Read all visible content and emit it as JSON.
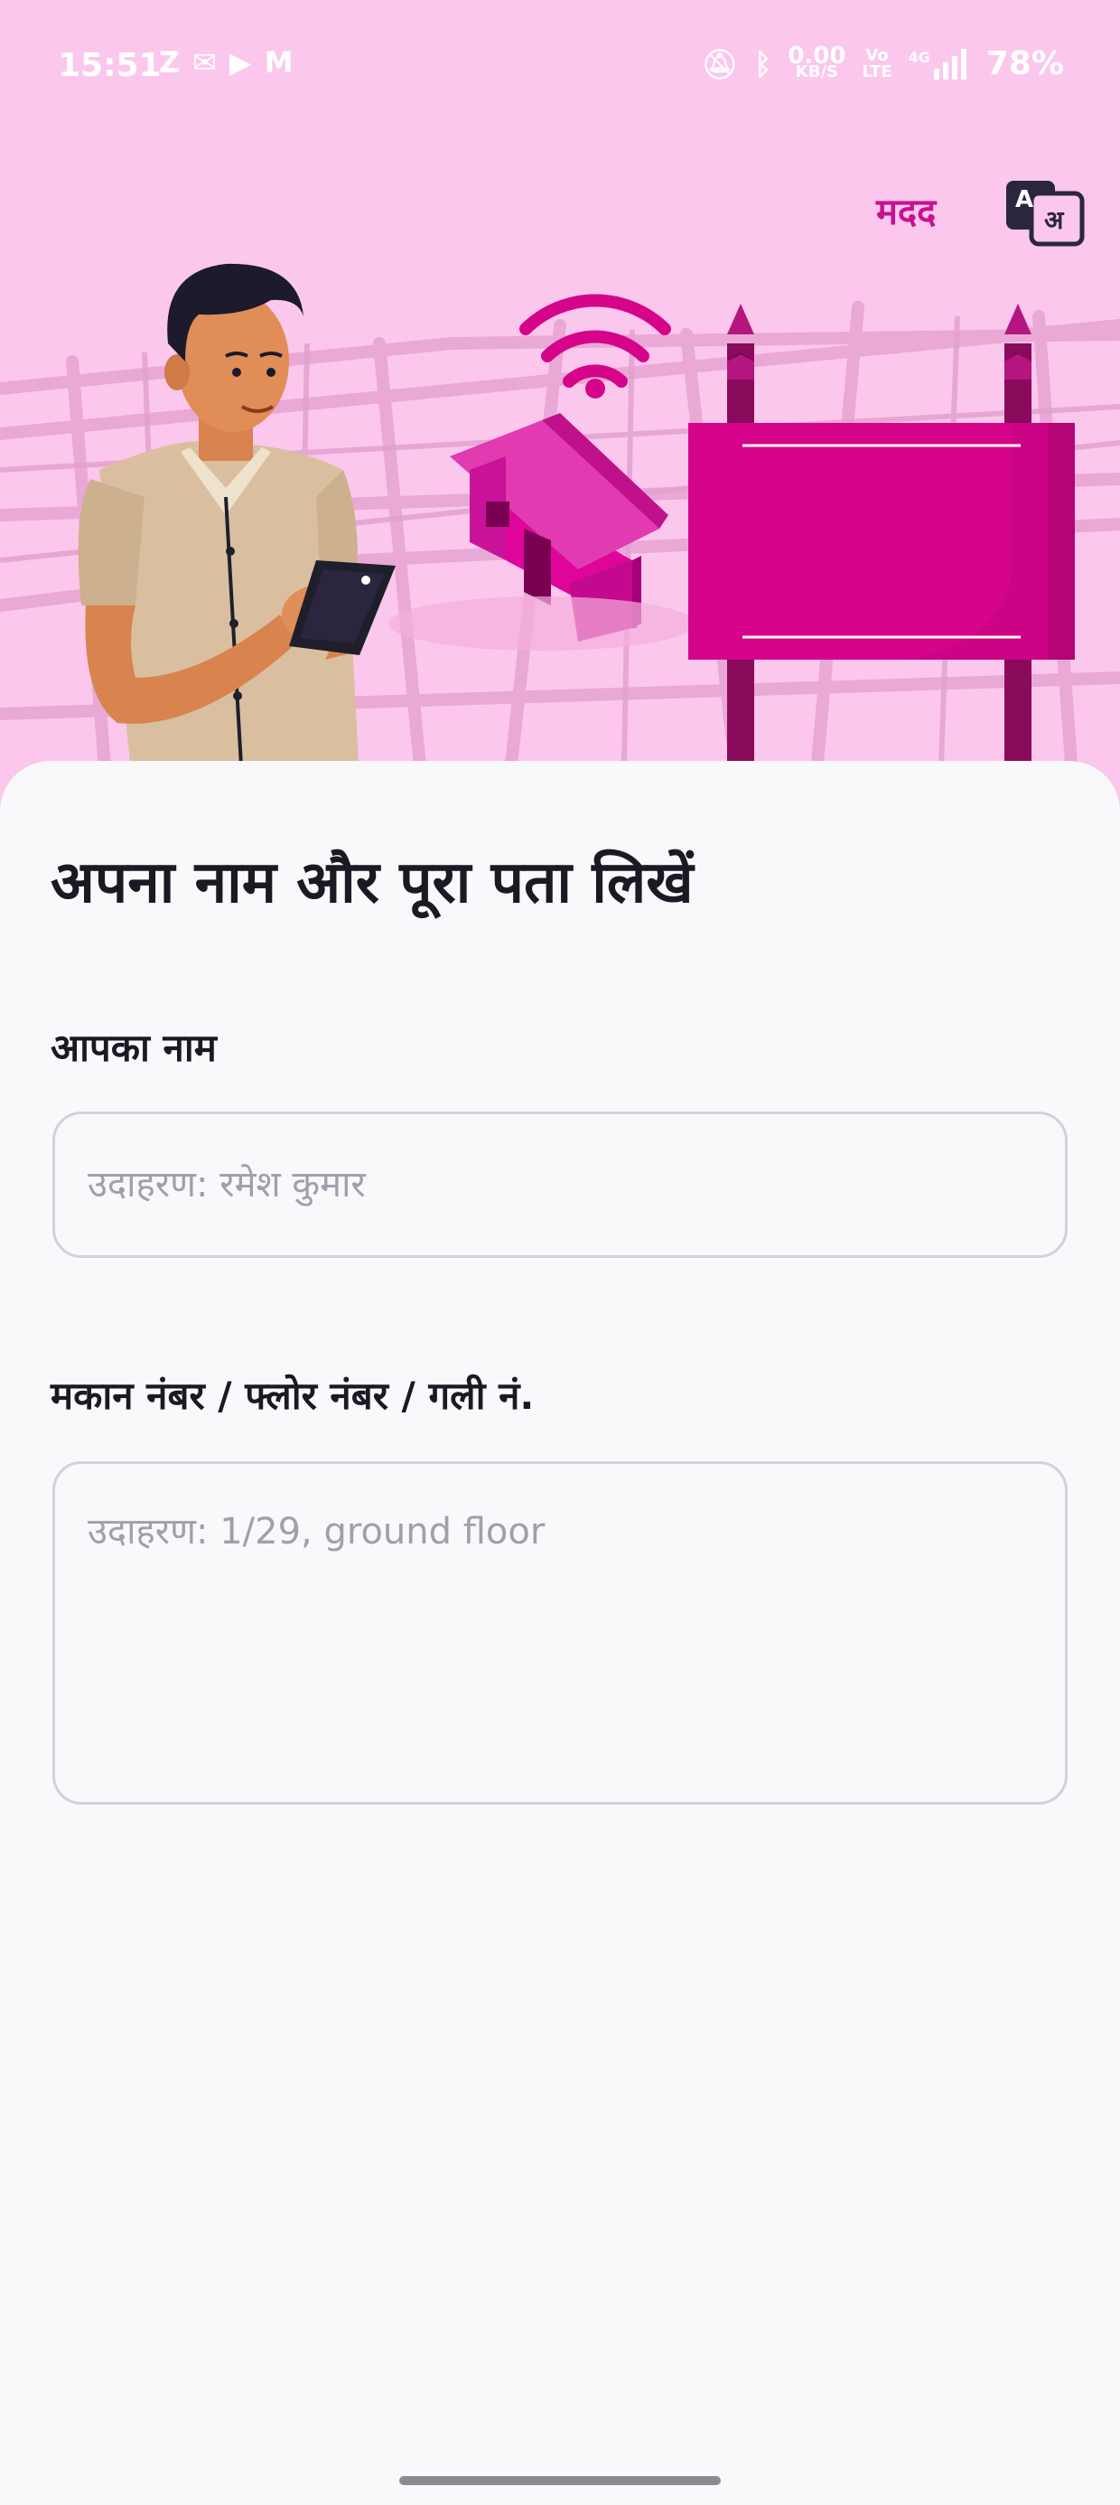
{
  "status_bar": {
    "time": "15:51",
    "app_icons": [
      "Z",
      "✉",
      "▶",
      "M"
    ],
    "network_speed_value": "0.00",
    "network_speed_unit": "KB/S",
    "volte_top": "Vo",
    "volte_bottom": "LTE",
    "signal_label": "4G",
    "battery": "78%"
  },
  "header": {
    "help_label": "मदद",
    "language_icon": "language-translate-icon",
    "language_latin": "A",
    "language_devanagari": "अ"
  },
  "page": {
    "title": "अपना नाम और पूरा पता लिखें"
  },
  "form": {
    "name_label": "आपका नाम",
    "name_placeholder": "उदाहरण: रमेश कुमार",
    "name_value": "",
    "address_label": "मकान नंबर / फ्लोर नंबर / गली नं.",
    "address_placeholder": "उदाहरण: 1/29, ground floor",
    "address_value": ""
  },
  "colors": {
    "hero_background": "#fcc7ec",
    "accent": "#c8128f",
    "sign_board": "#d6048a",
    "text_primary": "#1a1a24"
  }
}
